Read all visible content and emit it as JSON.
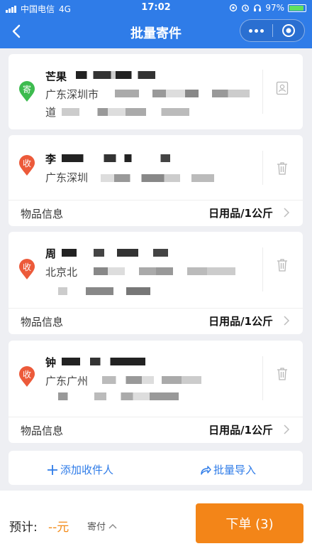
{
  "status_bar": {
    "carrier": "中国电信",
    "network": "4G",
    "time": "17:02",
    "battery": "97%"
  },
  "nav": {
    "title": "批量寄件"
  },
  "sender": {
    "badge": "寄",
    "name": "芒果",
    "addr_line1": "广东深圳市",
    "addr_line2": "道"
  },
  "receivers": [
    {
      "badge": "收",
      "name": "李",
      "addr_line1": "广东深圳",
      "addr_line2": "",
      "goods_label": "物品信息",
      "goods_value": "日用品/1公斤"
    },
    {
      "badge": "收",
      "name": "周",
      "addr_line1": "北京北",
      "addr_line2": "",
      "goods_label": "物品信息",
      "goods_value": "日用品/1公斤"
    },
    {
      "badge": "收",
      "name": "钟",
      "addr_line1": "广东广州",
      "addr_line2": "",
      "goods_label": "物品信息",
      "goods_value": "日用品/1公斤"
    }
  ],
  "actions": {
    "add_receiver": "添加收件人",
    "batch_import": "批量导入"
  },
  "footer": {
    "estimate_label": "预计:",
    "price": "--元",
    "send_label": "寄付",
    "order_button": "下单 (3)"
  },
  "colors": {
    "primary": "#2f7ce8",
    "sender_badge": "#3dbb4f",
    "receiver_badge": "#ec5a3a",
    "accent": "#f38518"
  }
}
